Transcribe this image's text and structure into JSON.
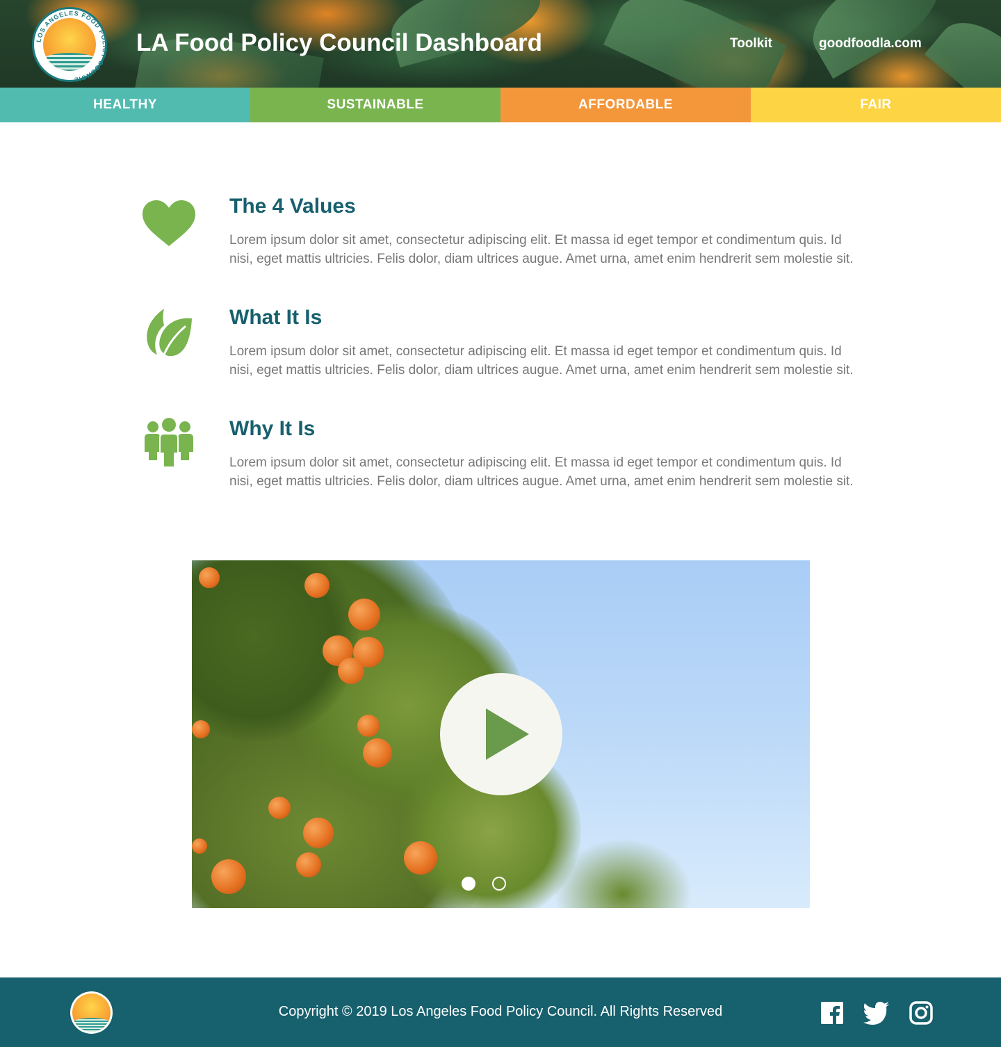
{
  "header": {
    "title": "LA Food Policy Council Dashboard",
    "links": [
      {
        "label": "Toolkit"
      },
      {
        "label": "goodfoodla.com"
      }
    ],
    "logo_text": "LOS ANGELES FOOD POLICY COUNCIL"
  },
  "nav": {
    "tabs": [
      {
        "label": "HEALTHY",
        "color": "#52bbb0"
      },
      {
        "label": "SUSTAINABLE",
        "color": "#79b44f"
      },
      {
        "label": "AFFORDABLE",
        "color": "#f4963a"
      },
      {
        "label": "FAIR",
        "color": "#fdd444"
      }
    ]
  },
  "sections": [
    {
      "icon": "heart-icon",
      "title": "The 4 Values",
      "body": "Lorem ipsum dolor sit amet, consectetur adipiscing elit. Et massa id eget tempor et condimentum quis. Id nisi, eget mattis ultricies. Felis dolor, diam ultrices augue. Amet urna, amet enim hendrerit sem molestie sit."
    },
    {
      "icon": "leaf-icon",
      "title": "What It Is",
      "body": "Lorem ipsum dolor sit amet, consectetur adipiscing elit. Et massa id eget tempor et condimentum quis. Id nisi, eget mattis ultricies. Felis dolor, diam ultrices augue. Amet urna, amet enim hendrerit sem molestie sit."
    },
    {
      "icon": "people-icon",
      "title": "Why It Is",
      "body": "Lorem ipsum dolor sit amet, consectetur adipiscing elit. Et massa id eget tempor et condimentum quis. Id nisi, eget mattis ultricies. Felis dolor, diam ultrices augue. Amet urna, amet enim hendrerit sem molestie sit."
    }
  ],
  "video": {
    "icon": "play-icon",
    "slides": 2,
    "active_slide": 1
  },
  "footer": {
    "copyright": "Copyright © 2019 Los Angeles Food Policy Council. All Rights Reserved",
    "social": [
      "facebook-icon",
      "twitter-icon",
      "instagram-icon"
    ]
  },
  "colors": {
    "accent_teal": "#17606d",
    "icon_green": "#79b44f",
    "body_text": "#777777"
  }
}
